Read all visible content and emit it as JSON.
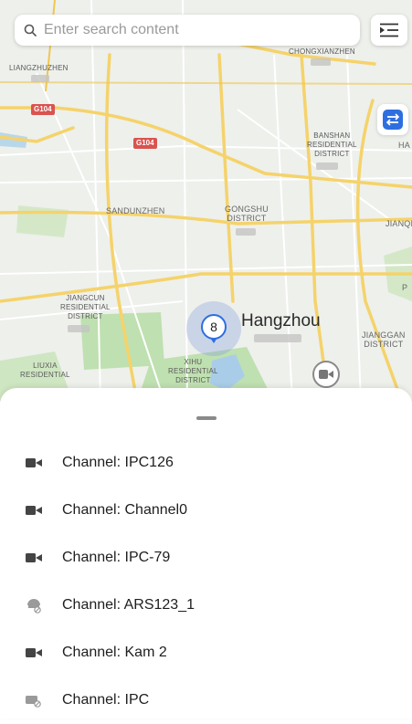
{
  "search": {
    "placeholder": "Enter search content"
  },
  "map": {
    "labels": {
      "liangzhuzhen": "LIANGZHUZHEN",
      "chongxianzhen": "CHONGXIANZHEN",
      "banshan": "BANSHAN\nRESIDENTIAL\nDISTRICT",
      "ha": "HA",
      "sandunzhen": "SANDUNZHEN",
      "gongshu": "GONGSHU\nDISTRICT",
      "jianqi": "JIANQI",
      "jiangcun": "JIANGCUN\nRESIDENTIAL\nDISTRICT",
      "city": "Hangzhou",
      "jianggan": "JIANGGAN\nDISTRICT",
      "xihu": "XIHU\nRESIDENTIAL\nDISTRICT",
      "liuxia": "LIUXIA\nRESIDENTIAL",
      "p": "P"
    },
    "road_shields": [
      "G104",
      "G104"
    ],
    "cluster_count": "8"
  },
  "channels": [
    {
      "label": "Channel: IPC126",
      "icon": "camera-icon"
    },
    {
      "label": "Channel: Channel0",
      "icon": "camera-icon"
    },
    {
      "label": "Channel: IPC-79",
      "icon": "camera-icon"
    },
    {
      "label": "Channel: ARS123_1",
      "icon": "dome-camera-offline-icon"
    },
    {
      "label": "Channel: Kam 2",
      "icon": "camera-icon"
    },
    {
      "label": "Channel: IPC",
      "icon": "camera-offline-icon"
    }
  ],
  "colors": {
    "accent": "#2d6fe0",
    "road_major": "#f5d36b",
    "road_shield": "#d9534f",
    "park": "#bfe0b0",
    "water": "#a9cde8"
  }
}
